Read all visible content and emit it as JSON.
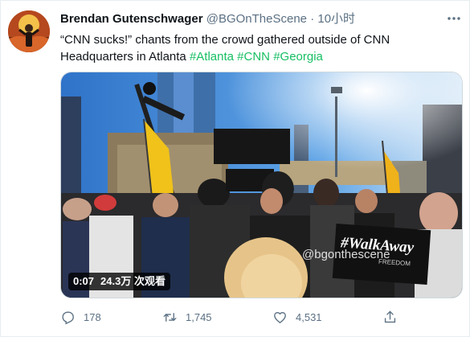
{
  "tweet": {
    "author_name": "Brendan Gutenschwager",
    "handle": "@BGOnTheScene",
    "separator": "·",
    "time": "10小时",
    "text_main": "“CNN sucks!” chants from the crowd gathered outside of CNN Headquarters in Atlanta",
    "hashtags": [
      "#Atlanta",
      "#CNN",
      "#Georgia"
    ]
  },
  "video": {
    "duration": "0:07",
    "views": "24.3万 次观看",
    "sign_text": "#WalkAway",
    "sign_subtext": "FREEDOM",
    "watermark": "@bgonthescene"
  },
  "actions": {
    "replies": "178",
    "retweets": "1,745",
    "likes": "4,531"
  },
  "icons": {
    "more": "more-icon",
    "reply": "reply-icon",
    "retweet": "retweet-icon",
    "like": "heart-icon",
    "share": "share-icon"
  },
  "colors": {
    "hashtag": "#17bf63",
    "secondary_text": "#5b7083",
    "border": "#e6ecf0"
  }
}
